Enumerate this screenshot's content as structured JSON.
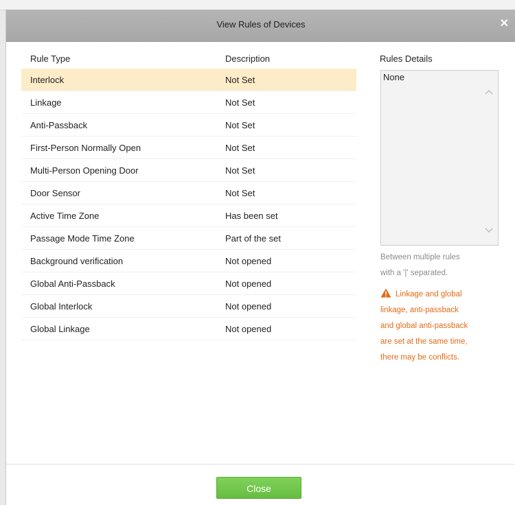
{
  "dialog": {
    "title": "View Rules of Devices",
    "close_icon": "close-icon"
  },
  "table": {
    "headers": {
      "rule_type": "Rule Type",
      "description": "Description"
    },
    "rows": [
      {
        "type": "Interlock",
        "desc": "Not Set"
      },
      {
        "type": "Linkage",
        "desc": "Not Set"
      },
      {
        "type": "Anti-Passback",
        "desc": "Not Set"
      },
      {
        "type": "First-Person Normally Open",
        "desc": "Not Set"
      },
      {
        "type": "Multi-Person Opening Door",
        "desc": "Not Set"
      },
      {
        "type": "Door Sensor",
        "desc": "Not Set"
      },
      {
        "type": "Active Time Zone",
        "desc": "Has been set"
      },
      {
        "type": "Passage Mode Time Zone",
        "desc": "Part of the set"
      },
      {
        "type": "Background verification",
        "desc": "Not opened"
      },
      {
        "type": "Global Anti-Passback",
        "desc": "Not opened"
      },
      {
        "type": "Global Interlock",
        "desc": "Not opened"
      },
      {
        "type": "Global Linkage",
        "desc": "Not opened"
      }
    ],
    "selected_index": 0
  },
  "details": {
    "label": "Rules Details",
    "content": "None",
    "hint_line1": "Between multiple rules",
    "hint_line2": "with a '|' separated.",
    "warning_line1": "Linkage and global",
    "warning_line2": "linkage, anti-passback",
    "warning_line3": "and global anti-passback",
    "warning_line4": "are set at the same time,",
    "warning_line5": "there may be conflicts."
  },
  "footer": {
    "close_label": "Close"
  },
  "colors": {
    "selected_row": "#fdecc8",
    "warning": "#e26b17",
    "button": "#6cc145",
    "titlebar": "#acacac"
  }
}
